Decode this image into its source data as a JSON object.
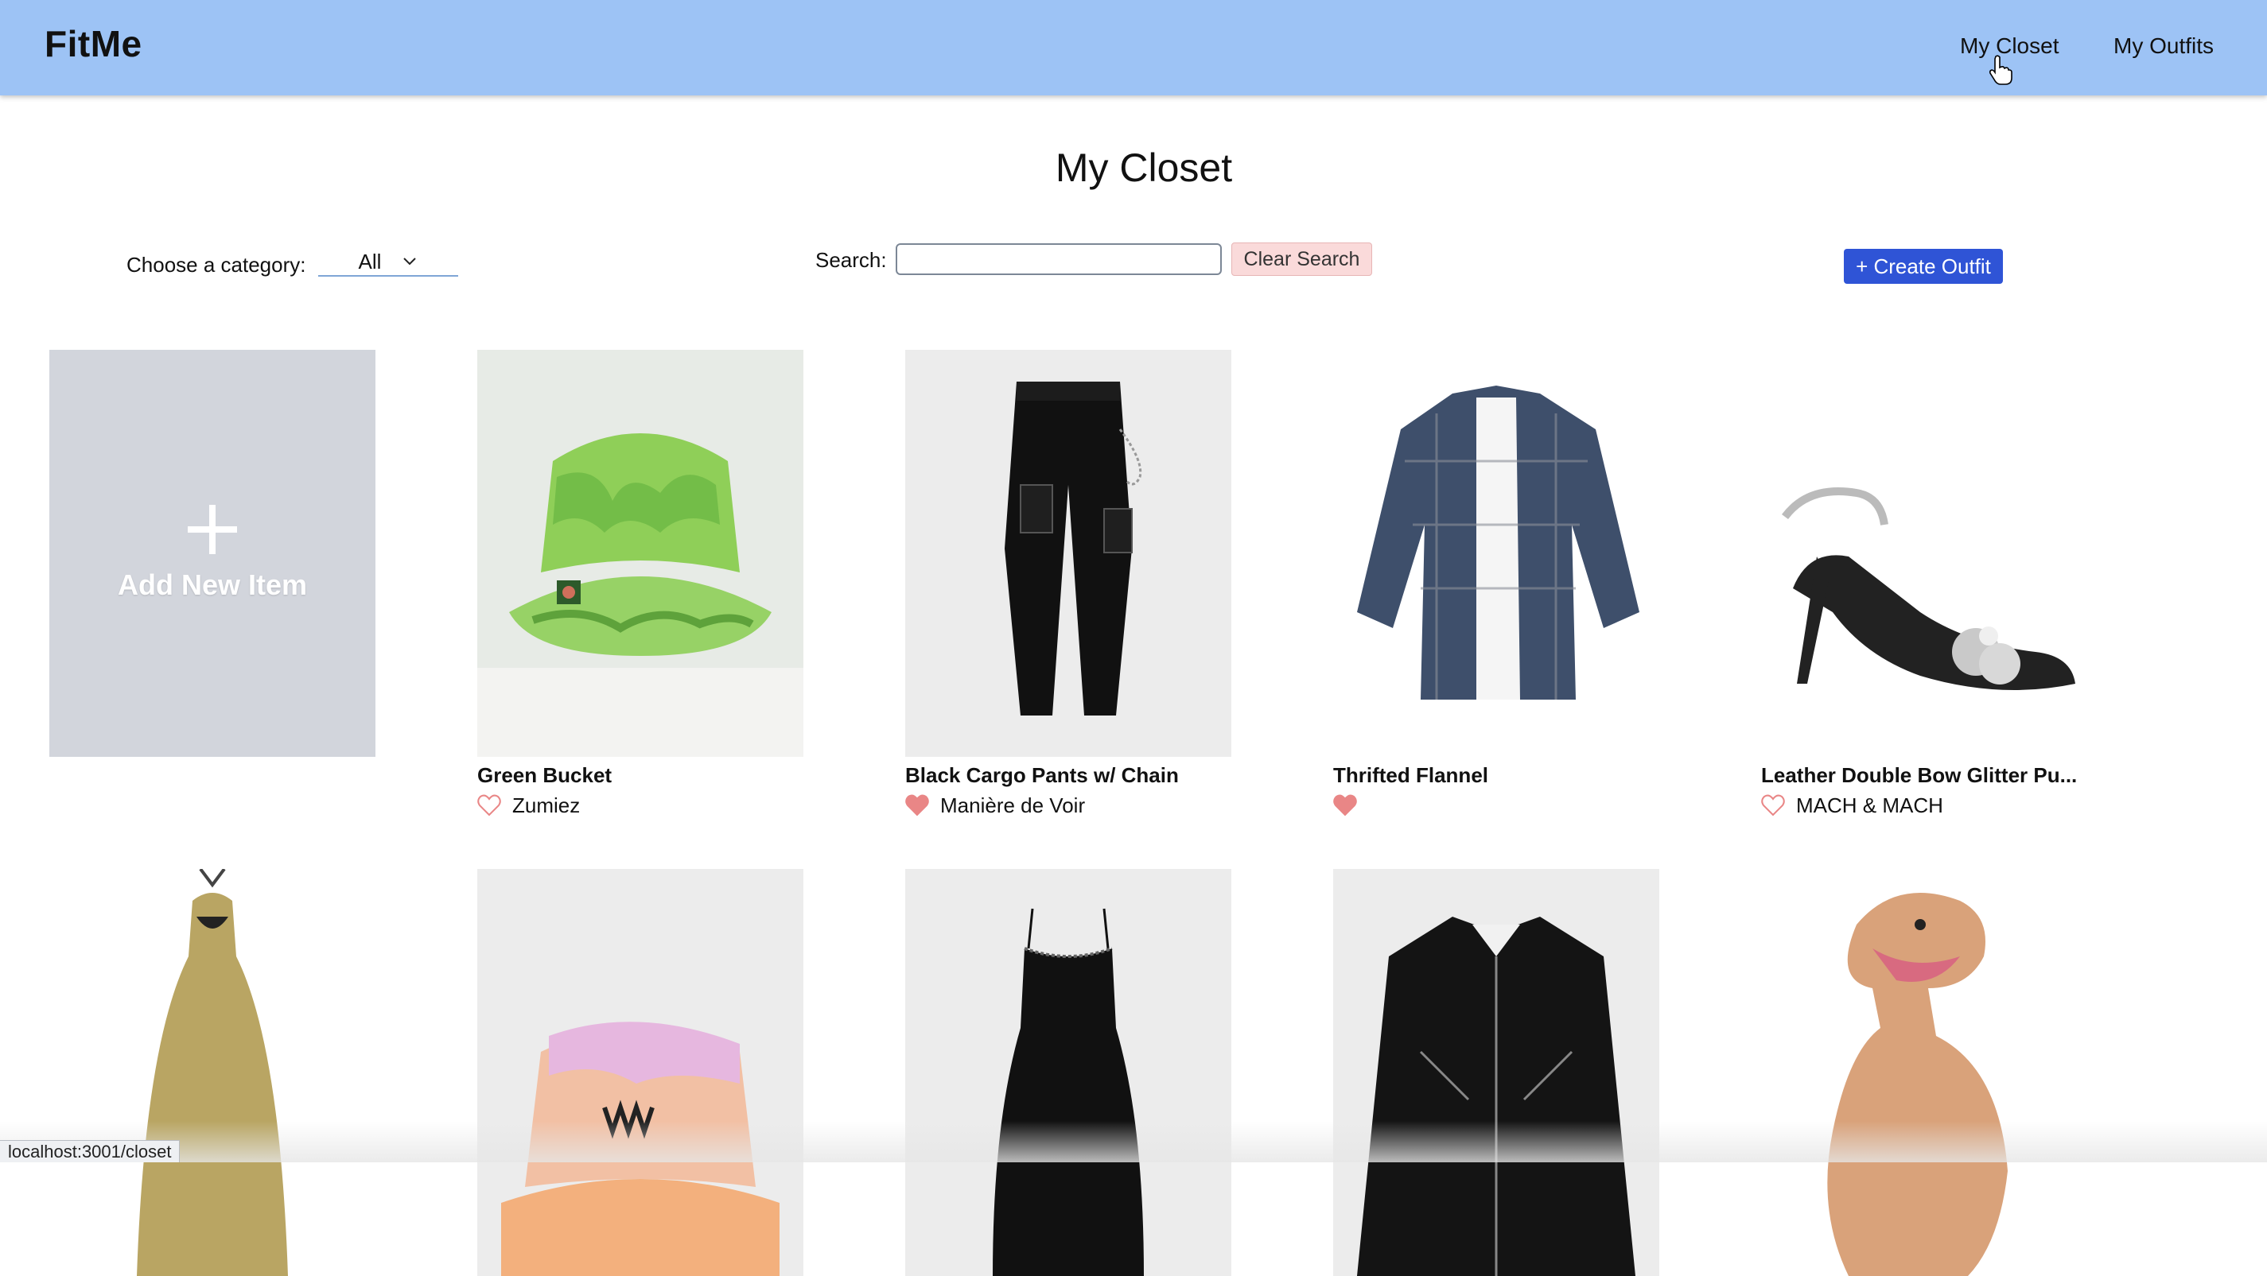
{
  "app": {
    "brand": "FitMe",
    "nav": [
      {
        "label": "My Closet"
      },
      {
        "label": "My Outfits"
      }
    ]
  },
  "page": {
    "title": "My Closet"
  },
  "controls": {
    "category_label": "Choose a category:",
    "category_value": "All",
    "search_label": "Search:",
    "search_value": "",
    "clear_label": "Clear Search",
    "create_label": "+ Create Outfit"
  },
  "add_item": {
    "label": "Add New Item"
  },
  "items": [
    {
      "title": "Green Bucket",
      "brand": "Zumiez",
      "favorite": false
    },
    {
      "title": "Black Cargo Pants w/ Chain",
      "brand": "Manière de Voir",
      "favorite": true
    },
    {
      "title": "Thrifted Flannel",
      "brand": "",
      "favorite": true
    },
    {
      "title": "Leather Double Bow Glitter Pu...",
      "brand": "MACH & MACH",
      "favorite": false
    }
  ],
  "status_url": "localhost:3001/closet",
  "colors": {
    "header": "#9dc3f5",
    "create": "#2f54d6",
    "clear": "#fadada",
    "heart": "#e98686"
  }
}
